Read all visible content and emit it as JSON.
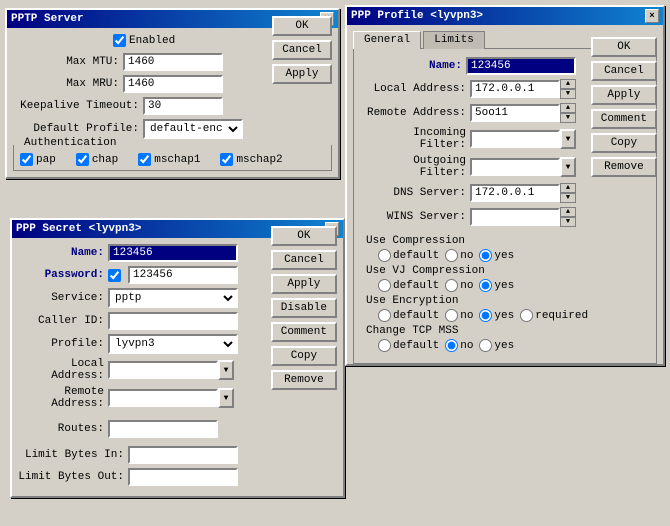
{
  "pptp_server": {
    "title": "PPTP Server",
    "enabled_label": "Enabled",
    "enabled_checked": true,
    "max_mtu_label": "Max MTU:",
    "max_mtu_value": "1460",
    "max_mru_label": "Max MRU:",
    "max_mru_value": "1460",
    "keepalive_label": "Keepalive Timeout:",
    "keepalive_value": "30",
    "default_profile_label": "Default Profile:",
    "default_profile_value": "default-encryptior",
    "auth_group_label": "Authentication",
    "pap_label": "pap",
    "chap_label": "chap",
    "mschap1_label": "mschap1",
    "mschap2_label": "mschap2",
    "ok_label": "OK",
    "cancel_label": "Cancel",
    "apply_label": "Apply"
  },
  "ppp_secret": {
    "title": "PPP Secret <lyvpn3>",
    "name_label": "Name:",
    "name_value": "123456",
    "password_label": "Password:",
    "password_value": "123456",
    "password_checked": true,
    "service_label": "Service:",
    "service_value": "pptp",
    "caller_id_label": "Caller ID:",
    "caller_id_value": "",
    "profile_label": "Profile:",
    "profile_value": "lyvpn3",
    "local_address_label": "Local Address:",
    "local_address_value": "",
    "remote_address_label": "Remote Address:",
    "remote_address_value": "",
    "routes_label": "Routes:",
    "routes_value": "",
    "limit_bytes_in_label": "Limit Bytes In:",
    "limit_bytes_in_value": "",
    "limit_bytes_out_label": "Limit Bytes Out:",
    "limit_bytes_out_value": "",
    "ok_label": "OK",
    "cancel_label": "Cancel",
    "apply_label": "Apply",
    "disable_label": "Disable",
    "comment_label": "Comment",
    "copy_label": "Copy",
    "remove_label": "Remove"
  },
  "ppp_profile": {
    "title": "PPP Profile <lyvpn3>",
    "tab_general": "General",
    "tab_limits": "Limits",
    "name_label": "Name:",
    "name_value": "123456",
    "local_address_label": "Local Address:",
    "local_address_value": "172.0.0.1",
    "remote_address_label": "Remote Address:",
    "remote_address_value": "5oo11",
    "incoming_filter_label": "Incoming Filter:",
    "incoming_filter_value": "",
    "outgoing_filter_label": "Outgoing Filter:",
    "outgoing_filter_value": "",
    "dns_server_label": "DNS Server:",
    "dns_server_value": "172.0.0.1",
    "wins_server_label": "WINS Server:",
    "wins_server_value": "",
    "use_compression_label": "Use Compression",
    "compression_default": "default",
    "compression_no": "no",
    "compression_yes": "yes",
    "compression_selected": "yes",
    "use_vj_compression_label": "Use VJ Compression",
    "vj_default": "default",
    "vj_no": "no",
    "vj_yes": "yes",
    "vj_selected": "yes",
    "use_encryption_label": "Use Encryption",
    "enc_default": "default",
    "enc_no": "no",
    "enc_yes": "yes",
    "enc_required": "required",
    "enc_selected": "yes",
    "change_tcp_mss_label": "Change TCP MSS",
    "tcp_default": "default",
    "tcp_no": "no",
    "tcp_yes": "yes",
    "tcp_selected": "no",
    "ok_label": "OK",
    "cancel_label": "Cancel",
    "apply_label": "Apply",
    "comment_label": "Comment",
    "copy_label": "Copy",
    "remove_label": "Remove"
  }
}
